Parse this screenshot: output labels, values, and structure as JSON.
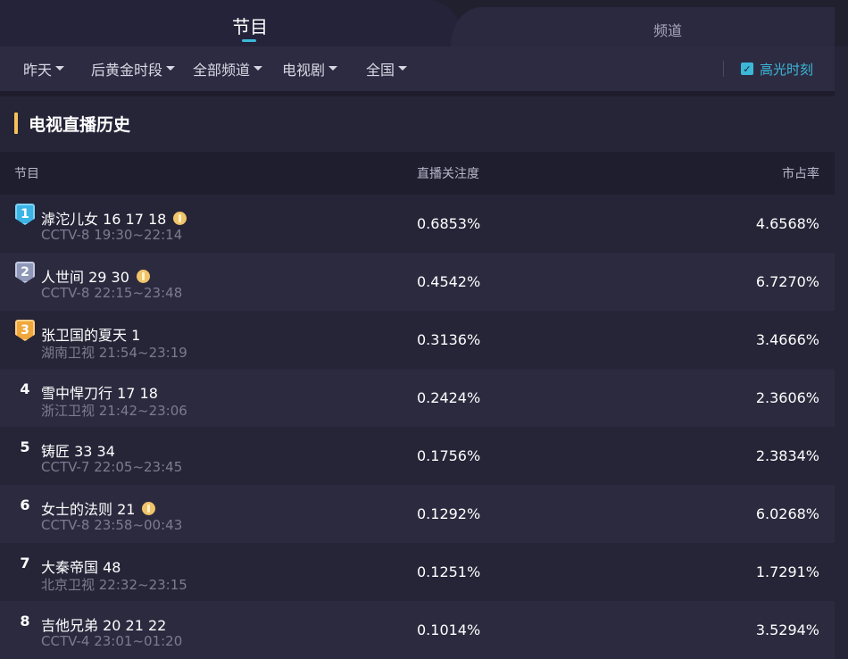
{
  "tabs": {
    "programs": "节目",
    "channels": "频道"
  },
  "filters": {
    "date": "昨天",
    "timeslot": "后黄金时段",
    "channel": "全部频道",
    "genre": "电视剧",
    "region": "全国",
    "highlight_label": "高光时刻",
    "highlight_checked": true
  },
  "section": {
    "title": "电视直播历史"
  },
  "table": {
    "headers": {
      "program": "节目",
      "attention": "直播关注度",
      "share": "市占率"
    },
    "rows": [
      {
        "rank": "1",
        "name": "滹沱儿女 16 17 18",
        "coin": true,
        "channel_time": "CCTV-8 19:30~22:14",
        "attention": "0.6853%",
        "share": "4.6568%"
      },
      {
        "rank": "2",
        "name": "人世间 29 30",
        "coin": true,
        "channel_time": "CCTV-8 22:15~23:48",
        "attention": "0.4542%",
        "share": "6.7270%"
      },
      {
        "rank": "3",
        "name": "张卫国的夏天 1",
        "coin": false,
        "channel_time": "湖南卫视 21:54~23:19",
        "attention": "0.3136%",
        "share": "3.4666%"
      },
      {
        "rank": "4",
        "name": "雪中悍刀行 17 18",
        "coin": false,
        "channel_time": "浙江卫视 21:42~23:06",
        "attention": "0.2424%",
        "share": "2.3606%"
      },
      {
        "rank": "5",
        "name": "铸匠 33 34",
        "coin": false,
        "channel_time": "CCTV-7 22:05~23:45",
        "attention": "0.1756%",
        "share": "2.3834%"
      },
      {
        "rank": "6",
        "name": "女士的法则 21",
        "coin": true,
        "channel_time": "CCTV-8 23:58~00:43",
        "attention": "0.1292%",
        "share": "6.0268%"
      },
      {
        "rank": "7",
        "name": "大秦帝国 48",
        "coin": false,
        "channel_time": "北京卫视 22:32~23:15",
        "attention": "0.1251%",
        "share": "1.7291%"
      },
      {
        "rank": "8",
        "name": "吉他兄弟 20 21 22",
        "coin": false,
        "channel_time": "CCTV-4 23:01~01:20",
        "attention": "0.1014%",
        "share": "3.5294%"
      }
    ]
  },
  "colors": {
    "accent": "#3bb8d8",
    "title_bar": "#f4c25a",
    "background": "#262437"
  }
}
